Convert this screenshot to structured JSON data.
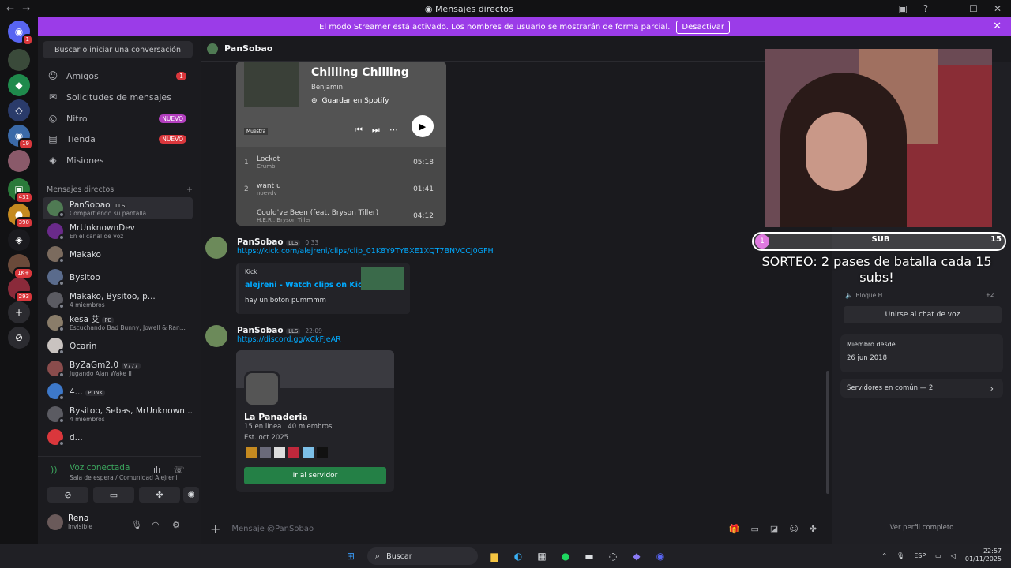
{
  "window": {
    "title": "Mensajes directos"
  },
  "banner": {
    "text": "El modo Streamer está activado. Los nombres de usuario se mostrarán de forma parcial.",
    "button": "Desactivar"
  },
  "guild_badges": [
    "1",
    "19",
    "431",
    "390",
    "1K+",
    "293"
  ],
  "sidebar": {
    "search_placeholder": "Buscar o iniciar una conversación",
    "nav": [
      {
        "label": "Amigos",
        "badge": "1"
      },
      {
        "label": "Solicitudes de mensajes",
        "badge": ""
      },
      {
        "label": "Nitro",
        "badge": "NUEVO"
      },
      {
        "label": "Tienda",
        "badge": "NUEVO"
      },
      {
        "label": "Misiones",
        "badge": ""
      }
    ],
    "dm_header": "Mensajes directos",
    "dms": [
      {
        "name": "PanSobao",
        "tag": "LLS",
        "sub": "Compartiendo su pantalla",
        "color": "#4f7a53"
      },
      {
        "name": "MrUnknownDev",
        "tag": "",
        "sub": "En el canal de voz",
        "color": "#6a2a8a"
      },
      {
        "name": "Makako",
        "tag": "",
        "sub": "",
        "color": "#7b6b5e"
      },
      {
        "name": "Bysitoo",
        "tag": "",
        "sub": "",
        "color": "#5a6b8c"
      },
      {
        "name": "Makako, Bysitoo, p...",
        "tag": "",
        "sub": "4 miembros",
        "color": "#5b5b62"
      },
      {
        "name": "kesa 艾",
        "tag": "PE",
        "sub": "Escuchando Bad Bunny, Jowell & Ran...",
        "color": "#8a7d6a"
      },
      {
        "name": "Ocarin",
        "tag": "",
        "sub": "",
        "color": "#c9c3c0"
      },
      {
        "name": "ByZaGm2.0",
        "tag": "V777",
        "sub": "Jugando Alan Wake II",
        "color": "#8a4c4c"
      },
      {
        "name": "4...",
        "tag": "PUNK",
        "sub": "",
        "color": "#3d78c9"
      },
      {
        "name": "Bysitoo, Sebas, MrUnknown...",
        "tag": "",
        "sub": "4 miembros",
        "color": "#5b5b62"
      },
      {
        "name": "d...",
        "tag": "",
        "sub": "",
        "color": "#da373c"
      }
    ]
  },
  "voice": {
    "status": "Voz conectada",
    "channel": "Sala de espera / Comunidad Alejreni"
  },
  "user": {
    "name": "Rena",
    "status": "Invisible"
  },
  "chat": {
    "header": "PanSobao",
    "spotify": {
      "title": "Chilling Chilling",
      "artist": "Benjamin",
      "save": "Guardar en Spotify",
      "label": "Muestra",
      "tracks": [
        {
          "n": "1",
          "title": "Locket",
          "artist": "Crumb",
          "time": "05:18"
        },
        {
          "n": "2",
          "title": "want u",
          "artist": "noevdv",
          "time": "01:41"
        },
        {
          "n": "",
          "title": "Could've Been (feat. Bryson Tiller)",
          "artist": "H.E.R., Bryson Tiller",
          "time": "04:12"
        }
      ]
    },
    "messages": [
      {
        "author": "PanSobao",
        "tag": "LLS",
        "time": "0:33",
        "link": "https://kick.com/alejreni/clips/clip_01K8Y9TYBXE1XQT7BNVCCJ0GFH",
        "embed": {
          "provider": "Kick",
          "title": "alejreni - Watch clips on Kick",
          "desc": "hay un boton pummmm"
        }
      },
      {
        "author": "PanSobao",
        "tag": "LLS",
        "time": "22:09",
        "link": "https://discord.gg/xCkFJeAR",
        "invite": {
          "server": "La Panaderia",
          "online": "15 en línea",
          "members": "40 miembros",
          "est": "Est. oct 2025",
          "button": "Ir al servidor"
        }
      }
    ],
    "composer_placeholder": "Mensaje @PanSobao"
  },
  "stream": {
    "sub_left": "1",
    "sub_label": "SUB",
    "sub_right": "15",
    "giveaway": "SORTEO: 2 pases de batalla cada 15 subs!"
  },
  "profile": {
    "voice_channel": "Bloque H",
    "voice_count": "+2",
    "join_voice": "Unirse al chat de voz",
    "member_since_label": "Miembro desde",
    "member_since": "26 jun 2018",
    "common": "Servidores en común — 2",
    "view_full": "Ver perfil completo"
  },
  "taskbar": {
    "search": "Buscar",
    "lang": "ESP",
    "time": "22:57",
    "date": "01/11/2025"
  }
}
